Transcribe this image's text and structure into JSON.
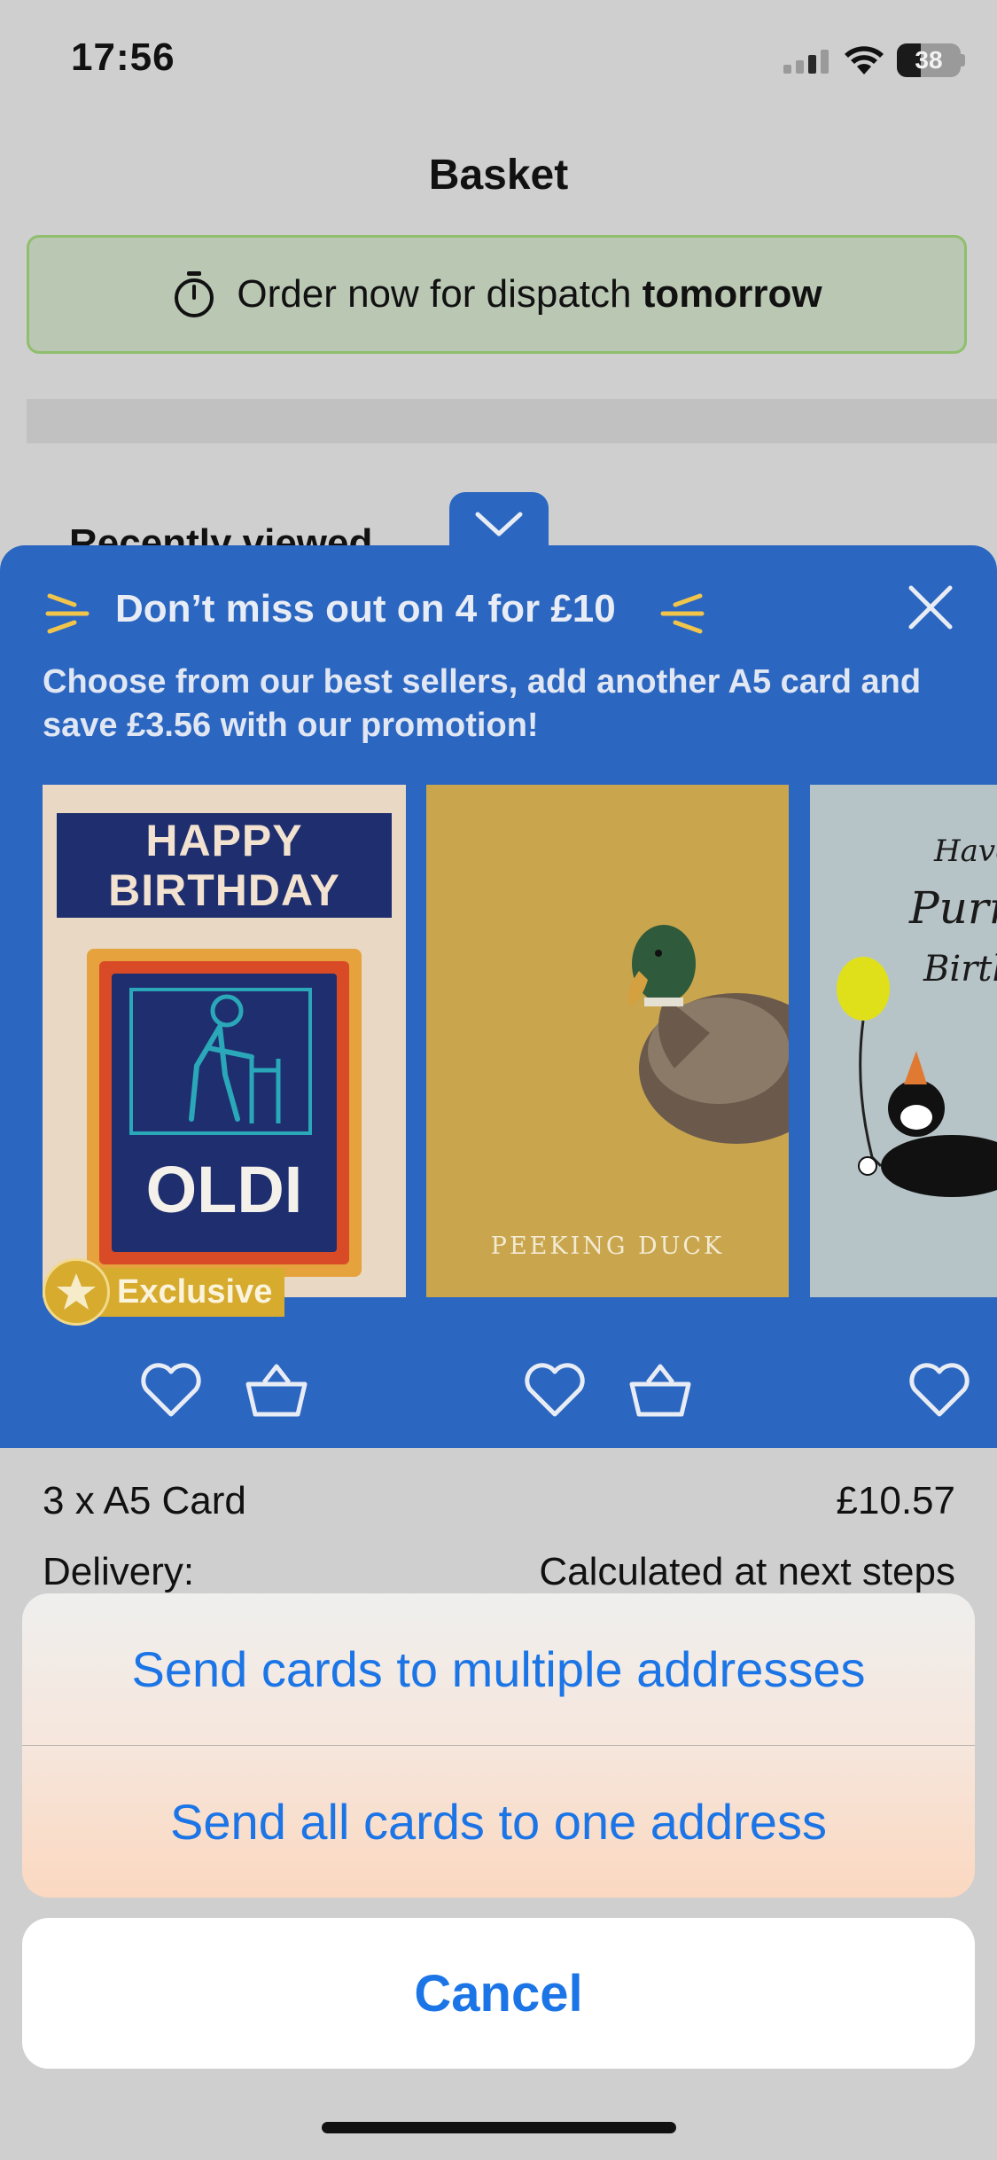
{
  "status_bar": {
    "time": "17:56",
    "battery": "38"
  },
  "header": {
    "title": "Basket"
  },
  "dispatch_banner": {
    "text_prefix": "Order now for dispatch ",
    "text_bold": "tomorrow"
  },
  "recently_viewed": {
    "heading": "Recently viewed"
  },
  "promo": {
    "title": "Don’t miss out on 4 for £10",
    "subtitle": "Choose from our best sellers, add another A5 card and save £3.56 with our promotion!",
    "cards": [
      {
        "headline_line1": "HAPPY",
        "headline_line2": "BIRTHDAY",
        "brand": "OLDI",
        "badge": "Exclusive"
      },
      {
        "caption": "PEEKING DUCK"
      },
      {
        "line1": "Have",
        "line2": "Purrf",
        "line3": "Birth"
      }
    ],
    "colors": {
      "panel": "#2b66c1"
    }
  },
  "totals": {
    "item_label": "3 x A5 Card",
    "item_value": "£10.57",
    "delivery_label": "Delivery:",
    "delivery_value": "Calculated at next steps"
  },
  "action_sheet": {
    "option1": "Send cards to multiple addresses",
    "option2": "Send all cards to one address",
    "cancel": "Cancel"
  },
  "icons": [
    "timer-icon",
    "chevron-down-icon",
    "close-icon",
    "sparkle-icon",
    "heart-icon",
    "basket-icon",
    "star-icon",
    "wifi-icon",
    "signal-icon",
    "battery-icon"
  ]
}
